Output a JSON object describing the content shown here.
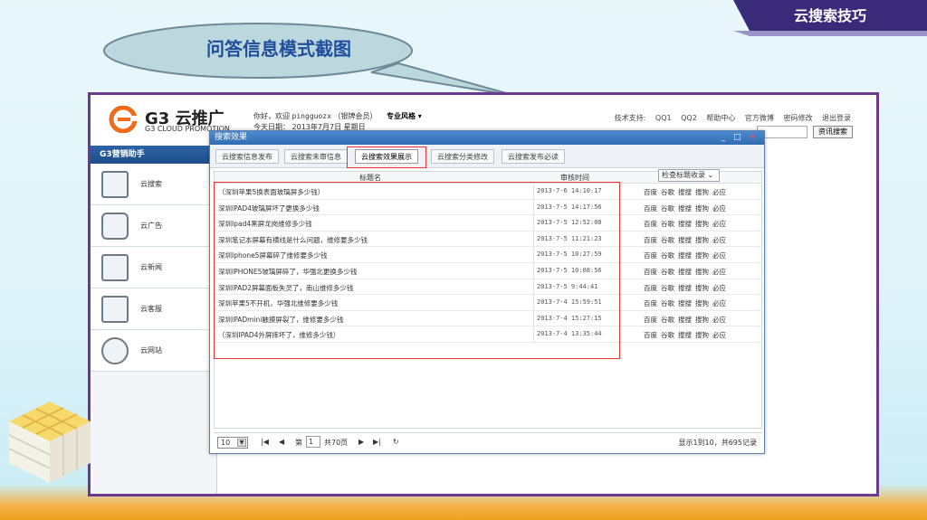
{
  "banner": {
    "title": "云搜索技巧"
  },
  "bubble": {
    "title": "问答信息模式截图"
  },
  "header": {
    "logo_main": "G3 云推广",
    "logo_sub": "G3 CLOUD PROMOTION",
    "welcome_prefix": "你好，欢迎",
    "username": "pingguozx",
    "member_level": "（银牌会员）",
    "style_menu": "专业风格 ▾",
    "date": "今天日期： 2013年7月7日 星期日",
    "top_links": [
      "技术支持:",
      "QQ1",
      "QQ2",
      "帮助中心",
      "官方微博",
      "密码修改",
      "退出登录"
    ],
    "search_button": "资讯搜索"
  },
  "sidebar": {
    "title": "G3营销助手",
    "items": [
      {
        "label": "云搜索"
      },
      {
        "label": "云广告"
      },
      {
        "label": "云新闻"
      },
      {
        "label": "云客服"
      },
      {
        "label": "云网站"
      }
    ]
  },
  "dialog": {
    "title": "搜索效果",
    "controls": "_ □ ✕",
    "tabs": [
      "云搜索信息发布",
      "云搜索未审信息",
      "云搜索效果展示",
      "云搜索分类修改",
      "云搜索发布必读"
    ],
    "active_tab": "云搜索效果展示",
    "columns": {
      "title": "标题名",
      "time": "审核时间",
      "filter": "检查标题收录 ⌄"
    },
    "rows": [
      {
        "title": "（深圳苹果5换表面玻璃屏多少钱）",
        "time": "2013-7-6 14:10:17"
      },
      {
        "title": "深圳IPAD4玻璃屏坏了更换多少钱",
        "time": "2013-7-5 14:17:56"
      },
      {
        "title": "深圳Ipad4黑屏龙岗维修多少钱",
        "time": "2013-7-5 12:52:08"
      },
      {
        "title": "深圳笔记本屏幕有横线是什么问题，维修要多少钱",
        "time": "2013-7-5 11:21:23"
      },
      {
        "title": "深圳Iphone5屏幕碎了维修要多少钱",
        "time": "2013-7-5 10:27:59"
      },
      {
        "title": "深圳IPHONE5玻璃屏碎了，华强北更换多少钱",
        "time": "2013-7-5 10:08:56"
      },
      {
        "title": "深圳IPAD2屏幕面板失灵了，南山维修多少钱",
        "time": "2013-7-5 9:44:41"
      },
      {
        "title": "深圳苹果5不开机，华强北维修要多少钱",
        "time": "2013-7-4 15:59:51"
      },
      {
        "title": "深圳IPADmini触摸屏裂了，维修要多少钱",
        "time": "2013-7-4 15:27:15"
      },
      {
        "title": "（深圳IPAD4外屏摔坏了，维修多少钱）",
        "time": "2013-7-4 13:35:44"
      }
    ],
    "engines": [
      "百度",
      "谷歌",
      "搜搜",
      "搜狗",
      "必应"
    ],
    "pager": {
      "page_size": "10",
      "page_label": "第",
      "page_value": "1",
      "total_pages": "共70页",
      "summary": "显示1到10，共695记录"
    }
  },
  "colors": {
    "frame": "#6a3a8e",
    "accent_blue": "#2f6cb2",
    "highlight": "#ee3333"
  }
}
